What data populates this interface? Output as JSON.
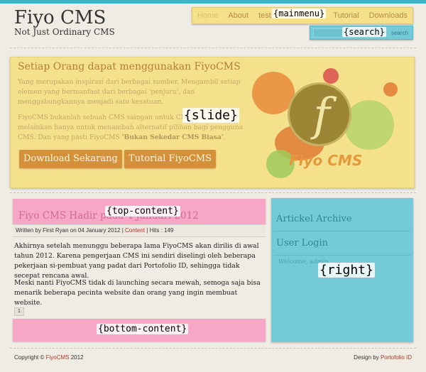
{
  "site": {
    "title": "Fiyo CMS",
    "tagline": "Not Just Ordinary CMS"
  },
  "mainmenu": {
    "items": [
      "Home",
      "About",
      "test"
    ],
    "items_right": [
      "Tutorial",
      "Downloads"
    ],
    "placeholder": "{mainmenu}"
  },
  "search": {
    "placeholder": "{search}",
    "button": "search"
  },
  "slide": {
    "placeholder": "{slide}",
    "heading": "Setiap Orang dapat menggunakan FiyoCMS",
    "para1": "Yang merupakan inspirasi dari berbagai sumber. Mengambil setiap elemen yang bermanfaat dari berbagai 'penjuru', dan menggabungkannya menjadi satu kesatuan.",
    "para2_a": "FiyoCMS bukanlah sebuah CMS saingan untuk CMS yang lain, melainkan hanya untuk menambah alternatif pilihan bagi pengguna CMS. Dan yang pasti FiyoCMS ",
    "para2_b": "'Bukan Sekedar CMS Biasa'",
    "para2_c": ".",
    "button1": "Download Sekarang",
    "button2": "Tutorial FiyoCMS",
    "logo_letter": "f",
    "logo_text": "Fiyo CMS"
  },
  "top_content": {
    "placeholder": "{top-content}",
    "post_title": "Fiyo CMS Hadir pada 4 Januari 2012"
  },
  "meta": {
    "written_by": "Written by First Ryan on 04 January 2012 |",
    "category": "Content",
    "hits": "| Hits : 149"
  },
  "article": {
    "para1": "Akhirnya setelah menunggu beberapa lama FiyoCMS akan dirilis di awal tahun 2012. Karena pengerjaan CMS ini sendiri diselingi oleh beberapa pekerjaan si-pembuat  yang padat dari Portofolio ID, sehingga tidak secepat rencana awal.",
    "para2": "Meski nanti FiyoCMS tidak di launching secara mewah, semoga saja bisa menarik beberapa pecinta website dan orang yang ingin membuat website."
  },
  "pager": {
    "page": "1"
  },
  "bottom_content": {
    "placeholder": "{bottom-content}"
  },
  "right": {
    "placeholder": "{right}",
    "widget1_title": "Artickel Archive",
    "widget2_title": "User Login",
    "welcome": "Welcome, admin"
  },
  "footer": {
    "copyright_prefix": "Copyright © ",
    "copyright_link": "FiyoCMS",
    "copyright_suffix": " 2012",
    "design_prefix": "Design by ",
    "design_link": "Portofolio ID"
  }
}
